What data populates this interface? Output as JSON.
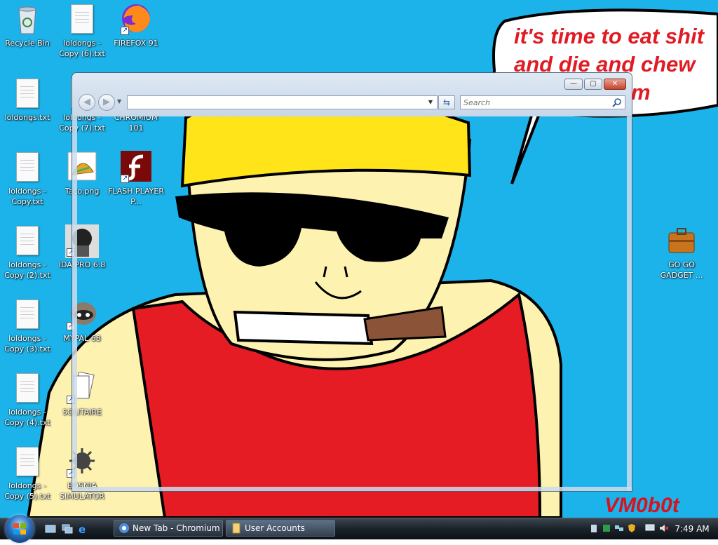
{
  "desktop": {
    "background_color": "#1cb3eb",
    "speech_bubble": {
      "line1": "it's time to eat shit",
      "line2": "and die and chew",
      "line3": "m"
    },
    "signature": "VM0b0t",
    "icons": [
      {
        "label": "Recycle Bin",
        "icon": "recycle-bin-icon"
      },
      {
        "label": "loldongs - Copy (6).txt",
        "icon": "text-file-icon"
      },
      {
        "label": "FIREFOX 91",
        "icon": "firefox-icon"
      },
      {
        "label": "loldongs.txt",
        "icon": "text-file-icon"
      },
      {
        "label": "loldongs - Copy (7).txt",
        "icon": "text-file-icon"
      },
      {
        "label": "CHROMIUM 101",
        "icon": "chromium-icon"
      },
      {
        "label": "loldongs - Copy.txt",
        "icon": "text-file-icon"
      },
      {
        "label": "Taco.png",
        "icon": "image-file-icon"
      },
      {
        "label": "FLASH PLAYER P...",
        "icon": "flash-player-icon"
      },
      {
        "label": "loldongs - Copy (2).txt",
        "icon": "text-file-icon"
      },
      {
        "label": "IDA PRO 6.8",
        "icon": "ida-pro-icon"
      },
      {
        "label": "loldongs - Copy (3).txt",
        "icon": "text-file-icon"
      },
      {
        "label": "MYPAL 68",
        "icon": "mypal-icon"
      },
      {
        "label": "loldongs - Copy (4).txt",
        "icon": "text-file-icon"
      },
      {
        "label": "SOLITAIRE",
        "icon": "solitaire-icon"
      },
      {
        "label": "loldongs - Copy (5).txt",
        "icon": "text-file-icon"
      },
      {
        "label": "BOSNIA SIMULATOR",
        "icon": "mine-icon"
      },
      {
        "label": "GO GO GADGET ...",
        "icon": "briefcase-icon"
      }
    ]
  },
  "window": {
    "title": "User Accounts",
    "address_value": "",
    "search_placeholder": "Search",
    "minimize": "minimize-icon",
    "maximize": "maximize-icon",
    "close": "close-icon"
  },
  "taskbar": {
    "buttons": [
      {
        "label": "New Tab - Chromium",
        "icon": "chromium-icon"
      },
      {
        "label": "User Accounts",
        "icon": "user-accounts-icon"
      }
    ],
    "clock": "7:49 AM",
    "colors": {
      "bar": "#1c232b",
      "accent": "#2c6fbd"
    }
  }
}
